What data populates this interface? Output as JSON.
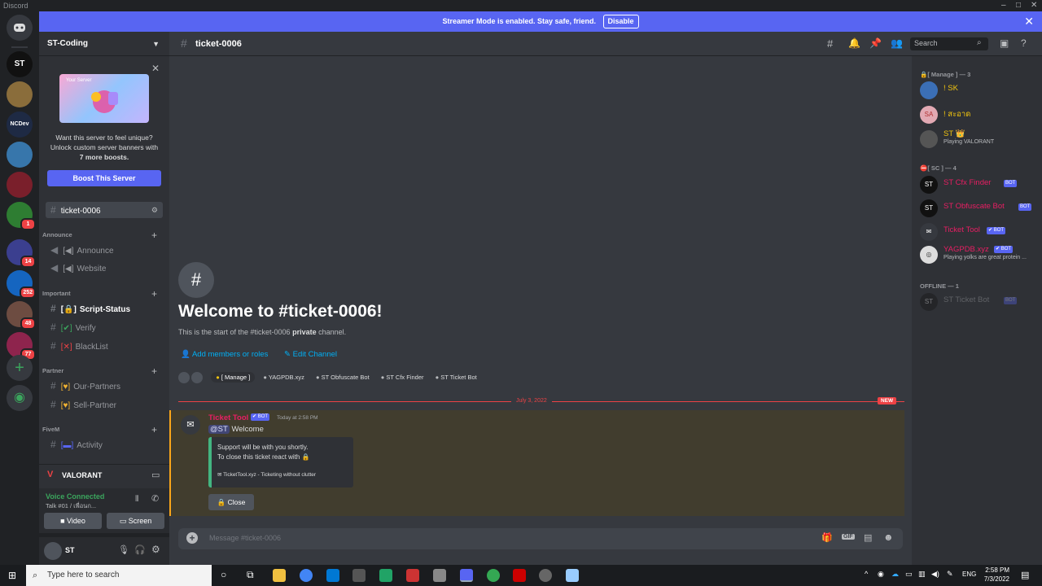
{
  "app": {
    "title": "Discord"
  },
  "streamer": {
    "text": "Streamer Mode is enabled. Stay safe, friend.",
    "button": "Disable"
  },
  "servers": [
    {
      "label": "",
      "badge": ""
    },
    {
      "label": "ST",
      "badge": ""
    },
    {
      "label": "",
      "badge": ""
    },
    {
      "label": "NCDev",
      "badge": ""
    },
    {
      "label": "",
      "badge": ""
    },
    {
      "label": "",
      "badge": ""
    },
    {
      "label": "",
      "badge": "1"
    },
    {
      "label": "",
      "badge": "14"
    },
    {
      "label": "",
      "badge": "252"
    },
    {
      "label": "",
      "badge": "48"
    },
    {
      "label": "",
      "badge": "77"
    }
  ],
  "server": {
    "name": "ST-Coding"
  },
  "boost": {
    "image_label": "Your Server",
    "line1": "Want this server to feel unique?",
    "line2": "Unlock custom server banners with",
    "line3": "7 more boosts.",
    "button": "Boost This Server"
  },
  "channels": {
    "selected": "ticket-0006",
    "categories": {
      "announce": "Announce",
      "important": "Important",
      "partner": "Partner",
      "fivem": "FiveM"
    },
    "announce_items": [
      "Announce",
      "Website"
    ],
    "important_items": [
      "Script-Status",
      "Verify",
      "BlackList"
    ],
    "partner_items": [
      "Our-Partners",
      "Sell-Partner"
    ],
    "fivem_items": [
      "Activity"
    ]
  },
  "voice_channel": {
    "name": "VALORANT"
  },
  "voice": {
    "status": "Voice Connected",
    "channel": "Talk #01 / เพื่อนก...",
    "video": "Video",
    "screen": "Screen"
  },
  "user": {
    "name": "ST"
  },
  "header": {
    "channel": "ticket-0006",
    "search_placeholder": "Search"
  },
  "welcome": {
    "title": "Welcome to #ticket-0006!",
    "subtitle_pre": "This is the start of the #ticket-0006 ",
    "subtitle_bold": "private",
    "subtitle_post": " channel.",
    "add_members": "Add members or roles",
    "edit_channel": "Edit Channel"
  },
  "member_chips": [
    "[ Manage ]",
    "YAGPDB.xyz",
    "ST Obfuscate Bot",
    "ST Cfx Finder",
    "ST Ticket Bot"
  ],
  "divider": {
    "date": "July 3, 2022",
    "new": "NEW"
  },
  "message": {
    "author": "Ticket Tool",
    "bot_tag": "BOT",
    "time": "Today at 2:58 PM",
    "mention": "@ST",
    "text": "Welcome",
    "embed_line1": "Support will be with you shortly.",
    "embed_line2": "To close this ticket react with",
    "embed_footer": "TicketTool.xyz - Ticketing without clutter",
    "close_button": "Close"
  },
  "composer": {
    "placeholder": "Message #ticket-0006"
  },
  "members": {
    "manage_header": "[ Manage ] — 3",
    "sc_header": "[ SC ] — 4",
    "offline_header": "OFFLINE — 1",
    "manage": [
      {
        "name": "! SK",
        "sub": "",
        "color": "#f1c40f"
      },
      {
        "name": "! สะอาด",
        "sub": "",
        "color": "#f1c40f"
      },
      {
        "name": "ST",
        "sub": "Playing VALORANT",
        "color": "#f1c40f"
      }
    ],
    "sc": [
      {
        "name": "ST Cfx Finder",
        "sub": "",
        "color": "#e91e63"
      },
      {
        "name": "ST Obfuscate Bot",
        "sub": "",
        "color": "#e91e63"
      },
      {
        "name": "Ticket Tool",
        "sub": "",
        "color": "#e91e63"
      },
      {
        "name": "YAGPDB.xyz",
        "sub": "Playing yolks are great protein ...",
        "color": "#e91e63"
      }
    ],
    "offline": [
      {
        "name": "ST Ticket Bot",
        "sub": "",
        "color": "#5c5e62"
      }
    ],
    "bot_tag": "BOT"
  },
  "taskbar": {
    "search": "Type here to search",
    "lang": "ENG",
    "time": "2:58 PM",
    "date": "7/3/2022"
  },
  "colors": {
    "accent": "#5865f2",
    "bg": "#36393f",
    "sidebar": "#2f3136",
    "highlight": "#413d2e"
  }
}
